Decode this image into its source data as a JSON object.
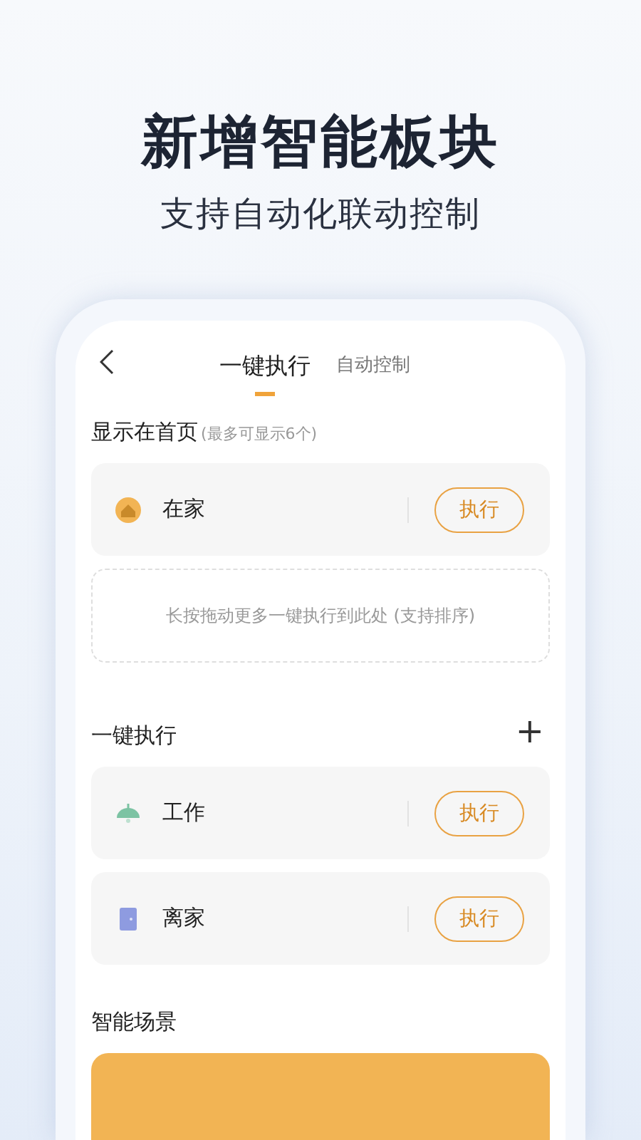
{
  "headline": "新增智能板块",
  "subheadline": "支持自动化联动控制",
  "tabs": [
    {
      "label": "一键执行",
      "selected": true
    },
    {
      "label": "自动控制",
      "selected": false
    }
  ],
  "homepage_section": {
    "title": "显示在首页",
    "note": "(最多可显示6个)",
    "items": [
      {
        "name": "在家",
        "action": "执行"
      }
    ],
    "drop_hint": "长按拖动更多一键执行到此处 (支持排序)"
  },
  "quick_section": {
    "title": "一键执行",
    "add": "+",
    "items": [
      {
        "name": "工作",
        "action": "执行"
      },
      {
        "name": "离家",
        "action": "执行"
      }
    ]
  },
  "scene_section": {
    "title": "智能场景"
  }
}
